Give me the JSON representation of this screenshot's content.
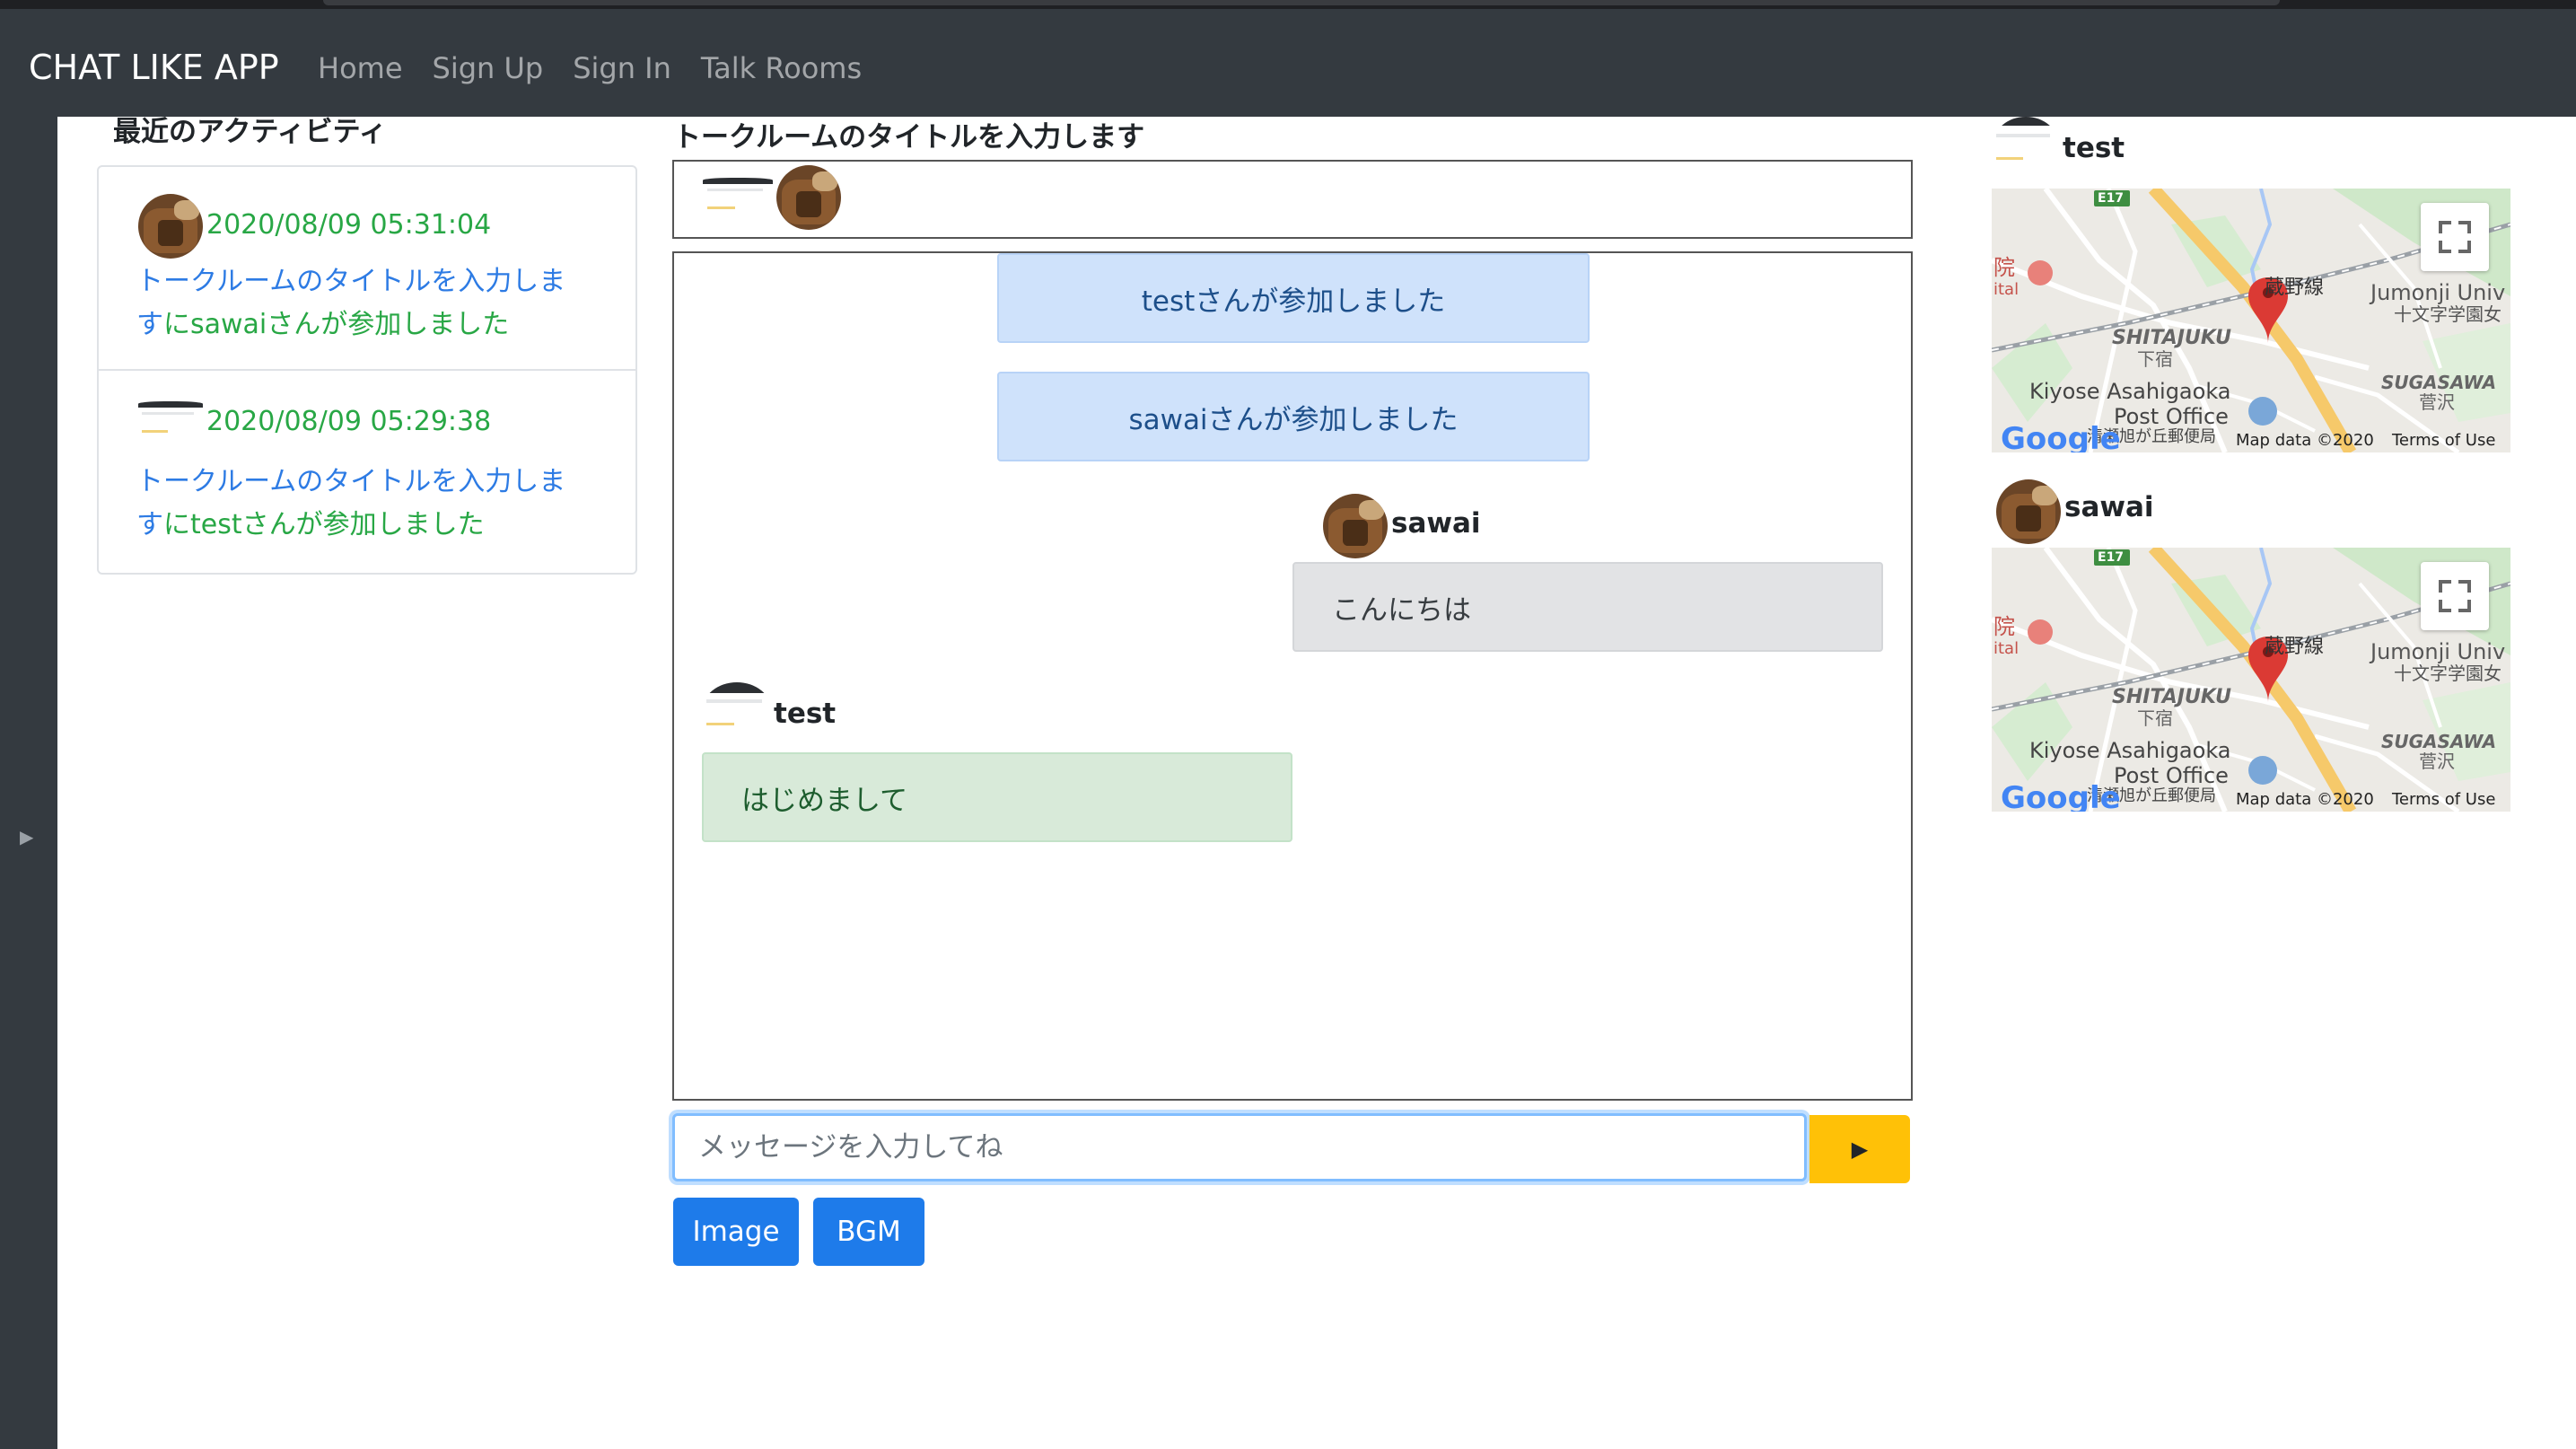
{
  "navbar": {
    "brand": "CHAT LIKE APP",
    "links": [
      "Home",
      "Sign Up",
      "Sign In",
      "Talk Rooms"
    ]
  },
  "sidebar_toggle": "▶",
  "activity": {
    "heading": "最近のアクティビティ",
    "items": [
      {
        "avatar": "bag-avatar",
        "timestamp": "2020/08/09 05:31:04",
        "room": "トークルームのタイトルを入力しま",
        "text_pre": "す",
        "text_post": "にsawaiさんが参加しました"
      },
      {
        "avatar": "screenshot-avatar",
        "timestamp": "2020/08/09 05:29:38",
        "room": "トークルームのタイトルを入力しま",
        "text_pre": "す",
        "text_post": "にtestさんが参加しました"
      }
    ]
  },
  "room": {
    "title": "トークルームのタイトルを入力します",
    "system_messages": [
      "testさんが参加しました",
      "sawaiさんが参加しました"
    ],
    "messages": [
      {
        "user": "sawai",
        "text": "こんにちは",
        "side": "right"
      },
      {
        "user": "test",
        "text": "はじめまして",
        "side": "left"
      }
    ],
    "input_placeholder": "メッセージを入力してね",
    "send_label": "▶",
    "buttons": [
      "Image",
      "BGM"
    ]
  },
  "maps": [
    {
      "user": "test",
      "labels": {
        "line": "蔵野線",
        "univ": "Jumonji Univ",
        "univ_jp": "十文字学園女",
        "area": "SHITAJUKU",
        "area_jp": "下宿",
        "area2": "SUGASAWA",
        "area2_jp": "菅沢",
        "post": "Kiyose Asahigaoka",
        "post2": "Post Office",
        "post_jp": "清瀬旭が丘郵便局",
        "hosp": "院",
        "hosp2": "ital",
        "road": "E17",
        "logo": "Google",
        "credit": "Map data ©2020",
        "terms": "Terms of Use"
      }
    },
    {
      "user": "sawai",
      "labels": {
        "line": "蔵野線",
        "univ": "Jumonji Univ",
        "univ_jp": "十文字学園女",
        "area": "SHITAJUKU",
        "area_jp": "下宿",
        "area2": "SUGASAWA",
        "area2_jp": "菅沢",
        "post": "Kiyose Asahigaoka",
        "post2": "Post Office",
        "post_jp": "清瀬旭が丘郵便局",
        "hosp": "院",
        "hosp2": "ital",
        "road": "E17",
        "logo": "Google",
        "credit": "Map data ©2020",
        "terms": "Terms of Use"
      }
    }
  ],
  "colors": {
    "navbar": "#343a40",
    "link_blue": "#2d7be4",
    "success_green": "#28a745",
    "primary": "#1e7bea",
    "warning": "#ffc107",
    "info_bg": "#cfe2fb",
    "secondary_bg": "#e2e3e5",
    "success_bg": "#d8ead9"
  }
}
